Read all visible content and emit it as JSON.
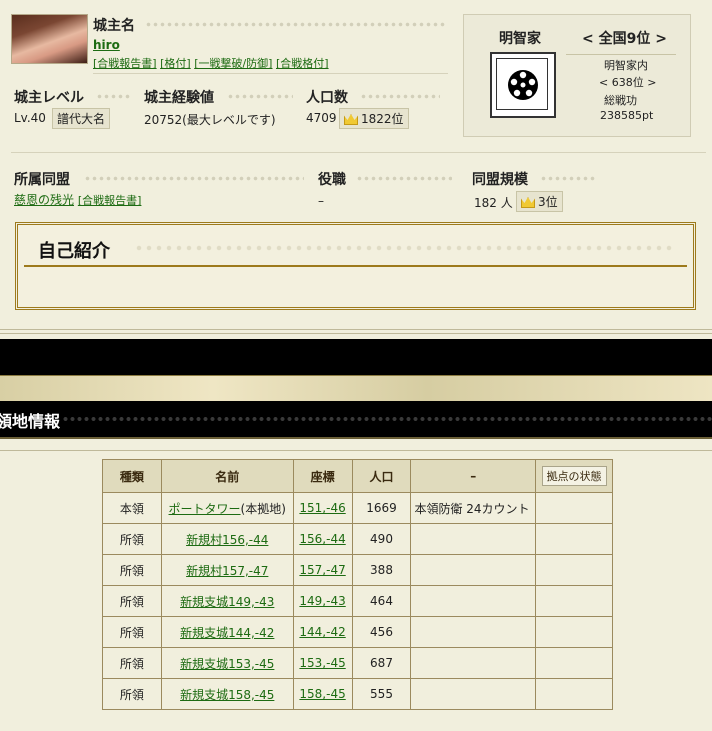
{
  "profile": {
    "name_label": "城主名",
    "username": "hiro",
    "links": [
      "[合戦報告書]",
      "[格付]",
      "[一戦撃破/防御]",
      "[合戦格付]"
    ]
  },
  "stats": {
    "level_label": "城主レベル",
    "level_value": "Lv.40",
    "rank_badge": "譜代大名",
    "exp_label": "城主経験値",
    "exp_value": "20752(最大レベルです)",
    "pop_label": "人口数",
    "pop_value": "4709",
    "pop_rank": "1822位"
  },
  "clan": {
    "name": "明智家",
    "national_rank": "全国9位",
    "internal_label": "明智家内",
    "internal_rank": "638位",
    "merit_label": "総戦功",
    "merit_value": "238585pt"
  },
  "alliance": {
    "label": "所属同盟",
    "name": "慈恩の残光",
    "report_link": "[合戦報告書]",
    "role_label": "役職",
    "role_value": "–",
    "scale_label": "同盟規模",
    "scale_value": "182 人",
    "scale_rank": "3位"
  },
  "intro": {
    "title": "自己紹介"
  },
  "territory": {
    "title": "領地情報",
    "headers": [
      "種類",
      "名前",
      "座標",
      "人口",
      "–"
    ],
    "status_button": "拠点の状態",
    "rows": [
      {
        "type": "本領",
        "name": "ポートタワー",
        "suffix": "(本拠地)",
        "coord": "151,-46",
        "pop": "1669",
        "extra": "本領防衛 24カウント"
      },
      {
        "type": "所領",
        "name": "新規村156,-44",
        "suffix": "",
        "coord": "156,-44",
        "pop": "490",
        "extra": ""
      },
      {
        "type": "所領",
        "name": "新規村157,-47",
        "suffix": "",
        "coord": "157,-47",
        "pop": "388",
        "extra": ""
      },
      {
        "type": "所領",
        "name": "新規支城149,-43",
        "suffix": "",
        "coord": "149,-43",
        "pop": "464",
        "extra": ""
      },
      {
        "type": "所領",
        "name": "新規支城144,-42",
        "suffix": "",
        "coord": "144,-42",
        "pop": "456",
        "extra": ""
      },
      {
        "type": "所領",
        "name": "新規支城153,-45",
        "suffix": "",
        "coord": "153,-45",
        "pop": "687",
        "extra": ""
      },
      {
        "type": "所領",
        "name": "新規支城158,-45",
        "suffix": "",
        "coord": "158,-45",
        "pop": "555",
        "extra": ""
      }
    ]
  },
  "colors": {
    "link": "#1d6b12",
    "gold": "#9d7a1c",
    "banner": "#000000"
  }
}
